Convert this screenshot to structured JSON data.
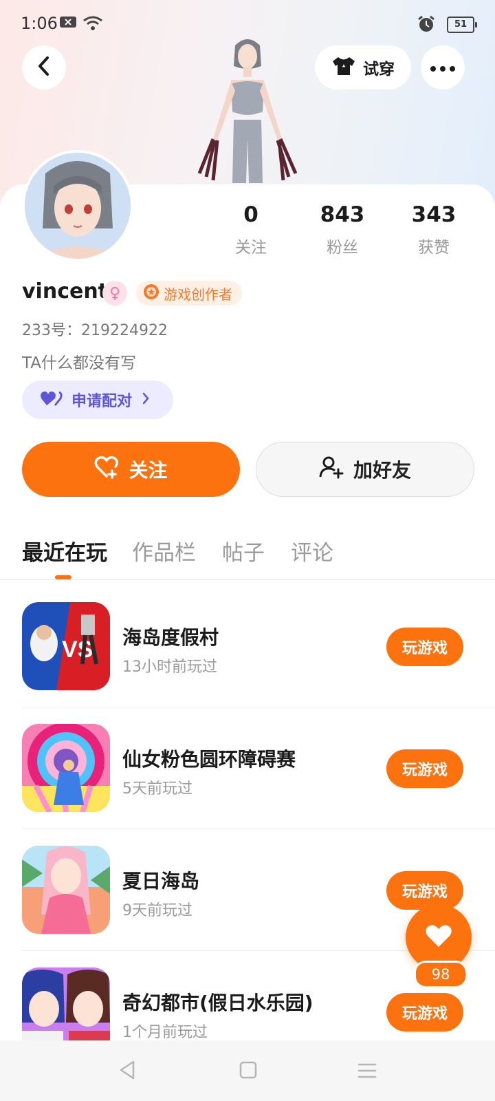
{
  "status_bar": {
    "time": "1:06",
    "battery": "51"
  },
  "header": {
    "try_on_label": "试穿"
  },
  "profile": {
    "username": "vincent",
    "badge": "游戏创作者",
    "uid": "233号：219224922",
    "bio": "TA什么都没有写",
    "pair_label": "申请配对",
    "stats": [
      {
        "value": "0",
        "label": "关注"
      },
      {
        "value": "843",
        "label": "粉丝"
      },
      {
        "value": "343",
        "label": "获赞"
      }
    ]
  },
  "actions": {
    "follow_label": "关注",
    "add_friend_label": "加好友"
  },
  "tabs": [
    "最近在玩",
    "作品栏",
    "帖子",
    "评论"
  ],
  "games": [
    {
      "title": "海岛度假村",
      "time": "13小时前玩过",
      "button": "玩游戏"
    },
    {
      "title": "仙女粉色圆环障碍赛",
      "time": "5天前玩过",
      "button": "玩游戏"
    },
    {
      "title": "夏日海岛",
      "time": "9天前玩过",
      "button": "玩游戏"
    },
    {
      "title": "奇幻都市(假日水乐园)",
      "time": "1个月前玩过",
      "button": "玩游戏"
    }
  ],
  "fab": {
    "count": "98"
  },
  "colors": {
    "accent": "#fb720f",
    "pair": "#5e55d8"
  }
}
